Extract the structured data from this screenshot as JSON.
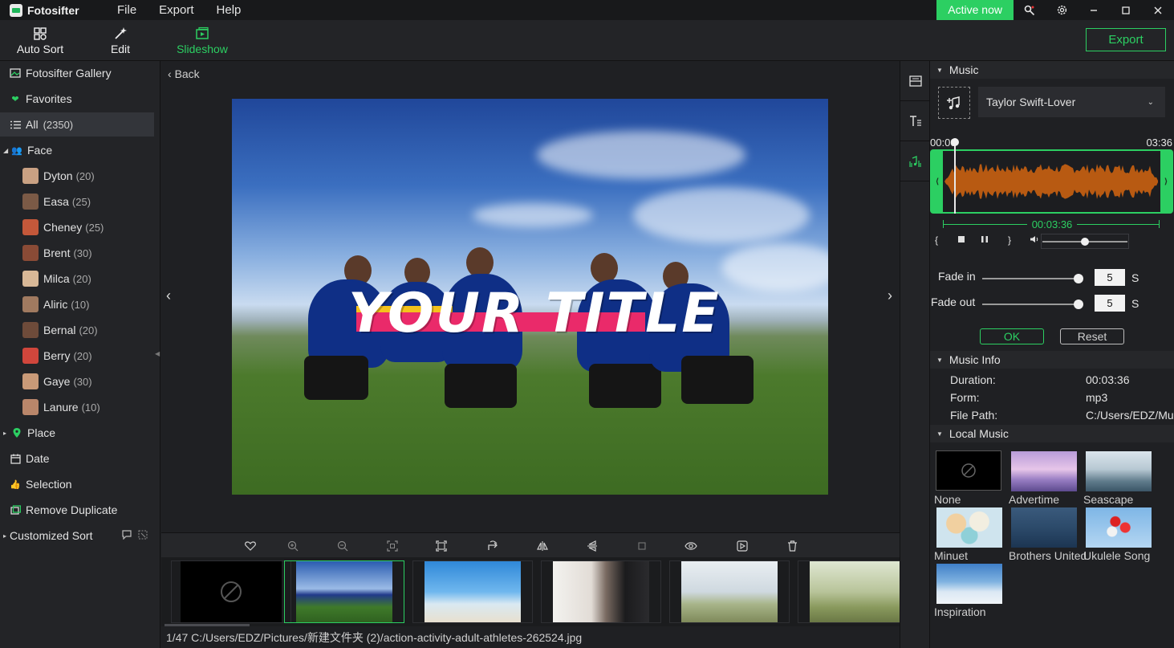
{
  "app": {
    "name": "Fotosifter"
  },
  "menu": [
    "File",
    "Export",
    "Help"
  ],
  "titlebar": {
    "active_now": "Active now"
  },
  "toolbar": {
    "auto_sort": "Auto Sort",
    "edit": "Edit",
    "slideshow": "Slideshow",
    "export": "Export"
  },
  "sidebar": {
    "gallery": "Fotosifter Gallery",
    "favorites": "Favorites",
    "all": "All",
    "all_count": "(2350)",
    "face": "Face",
    "faces": [
      {
        "name": "Dyton",
        "count": "(20)"
      },
      {
        "name": "Easa",
        "count": "(25)"
      },
      {
        "name": "Cheney",
        "count": "(25)"
      },
      {
        "name": "Brent",
        "count": "(30)"
      },
      {
        "name": "Milca",
        "count": "(20)"
      },
      {
        "name": "Aliric",
        "count": "(10)"
      },
      {
        "name": "Bernal",
        "count": "(20)"
      },
      {
        "name": "Berry",
        "count": "(20)"
      },
      {
        "name": "Gaye",
        "count": "(30)"
      },
      {
        "name": "Lanure",
        "count": "(10)"
      }
    ],
    "place": "Place",
    "date": "Date",
    "selection": "Selection",
    "remove_duplicate": "Remove Duplicate",
    "customized_sort": "Customized Sort"
  },
  "main": {
    "back": "Back",
    "slide_title": "YOUR TITLE"
  },
  "status": {
    "path": "1/47  C:/Users/EDZ/Pictures/新建文件夹 (2)/action-activity-adult-athletes-262524.jpg"
  },
  "music": {
    "section": "Music",
    "track": "Taylor Swift-Lover",
    "time_start": "00:00",
    "time_end": "03:36",
    "duration_display": "00:03:36",
    "volume_fraction": 0.5,
    "fade_in_label": "Fade in",
    "fade_in_value": "5",
    "fade_out_label": "Fade out",
    "fade_out_value": "5",
    "unit": "S",
    "ok": "OK",
    "reset": "Reset"
  },
  "music_info": {
    "section": "Music Info",
    "duration_label": "Duration:",
    "duration": "00:03:36",
    "form_label": "Form:",
    "form": "mp3",
    "path_label": "File Path:",
    "path": "C:/Users/EDZ/Mu"
  },
  "local_music": {
    "section": "Local Music",
    "items": [
      "None",
      "Advertime",
      "Seascape",
      "Minuet",
      "Brothers United",
      "Ukulele Song",
      "Inspiration"
    ]
  },
  "colors": {
    "accent": "#2ccf62",
    "title_band": "#ea2a6a",
    "waveform": "#b85a12"
  }
}
